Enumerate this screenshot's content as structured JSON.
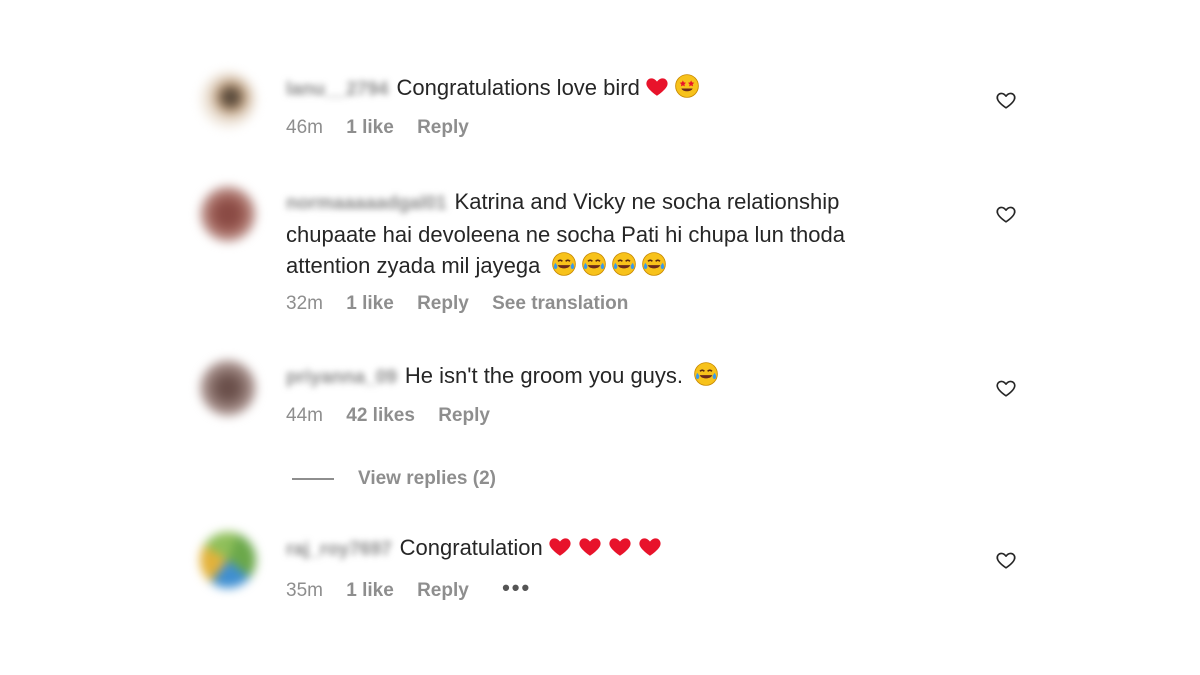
{
  "comments": [
    {
      "username": "lanu__2794",
      "text": "Congratulations love bird",
      "emojis": [
        "heart-emoji",
        "star-eyes-emoji"
      ],
      "time": "46m",
      "likes": "1 like",
      "reply": "Reply"
    },
    {
      "username": "normaaaaadgal01",
      "text_lines": [
        "Katrina and Vicky ne socha relationship",
        "chupaate hai devoleena ne socha Pati hi chupa lun thoda",
        "attention zyada mil jayega"
      ],
      "emojis": [
        "joy-emoji",
        "joy-emoji",
        "joy-emoji",
        "joy-emoji"
      ],
      "time": "32m",
      "likes": "1 like",
      "reply": "Reply",
      "translate": "See translation"
    },
    {
      "username": "priyanna_09",
      "text": "He isn't the groom you guys.",
      "emojis": [
        "joy-emoji"
      ],
      "time": "44m",
      "likes": "42 likes",
      "reply": "Reply",
      "view_replies": "View replies (2)"
    },
    {
      "username": "raj_roy7697",
      "text": "Congratulation",
      "emojis": [
        "heart-emoji",
        "heart-emoji",
        "heart-emoji",
        "heart-emoji"
      ],
      "time": "35m",
      "likes": "1 like",
      "reply": "Reply",
      "more": "•••"
    }
  ],
  "colors": {
    "text": "#262626",
    "muted": "#8e8e8e",
    "heart_red": "#e8132b",
    "emoji_yellow": "#f7c21b"
  },
  "icons": {
    "like": "heart-outline-icon"
  }
}
